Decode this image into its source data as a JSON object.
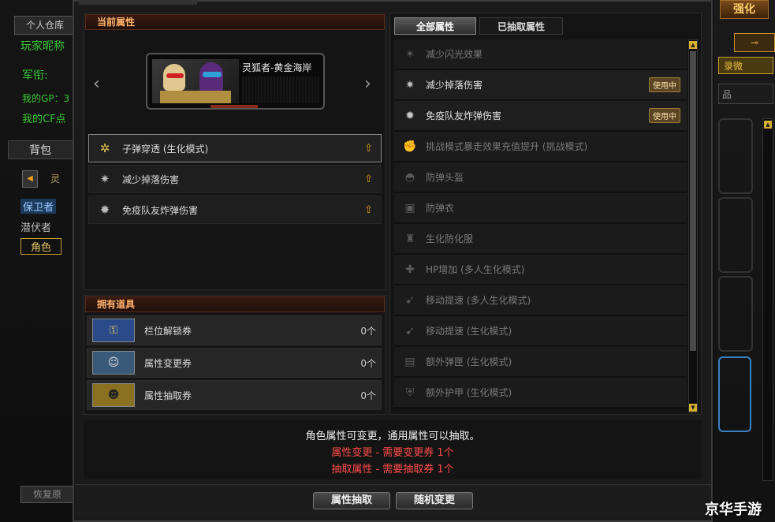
{
  "left_bg": {
    "tab_personal": "个人仓库",
    "player_nick": "玩家昵称",
    "rank": "军衔:",
    "gp": "我的GP：3",
    "cp": "我的CF点",
    "bag": "背包",
    "bag_item": "灵",
    "side_items": [
      "保卫者",
      "潜伏者",
      "角色"
    ],
    "bottom_button": "恢复原"
  },
  "right_bg": {
    "top_button": "强化",
    "middle_label": "录微",
    "small_label": "品"
  },
  "left_panel": {
    "header": "当前属性",
    "character_name": "灵狐者-黄金海岸",
    "attributes": [
      {
        "icon": "bullet-pierce-icon",
        "label": "子弹穿透 (生化模式)",
        "selected": true
      },
      {
        "icon": "fall-damage-icon",
        "label": "减少掉落伤害",
        "selected": false
      },
      {
        "icon": "grenade-immunity-icon",
        "label": "免疫队友炸弹伤害",
        "selected": false
      }
    ]
  },
  "items_panel": {
    "header": "拥有道具",
    "items": [
      {
        "label": "栏位解锁券",
        "count": "0个"
      },
      {
        "label": "属性变更券",
        "count": "0个"
      },
      {
        "label": "属性抽取券",
        "count": "0个"
      }
    ]
  },
  "right_panel": {
    "tabs": [
      "全部属性",
      "已抽取属性"
    ],
    "properties": [
      {
        "label": "减少闪光效果",
        "active": false,
        "badge": ""
      },
      {
        "label": "减少掉落伤害",
        "active": true,
        "badge": "使用中"
      },
      {
        "label": "免疫队友炸弹伤害",
        "active": true,
        "badge": "使用中"
      },
      {
        "label": "挑战模式暴走效果充值提升 (挑战模式)",
        "active": false,
        "badge": ""
      },
      {
        "label": "防弹头盔",
        "active": false,
        "badge": ""
      },
      {
        "label": "防弹衣",
        "active": false,
        "badge": ""
      },
      {
        "label": "生化防化服",
        "active": false,
        "badge": ""
      },
      {
        "label": "HP增加 (多人生化模式)",
        "active": false,
        "badge": ""
      },
      {
        "label": "移动提速 (多人生化模式)",
        "active": false,
        "badge": ""
      },
      {
        "label": "移动提速 (生化模式)",
        "active": false,
        "badge": ""
      },
      {
        "label": "额外弹匣 (生化模式)",
        "active": false,
        "badge": ""
      },
      {
        "label": "额外护甲 (生化模式)",
        "active": false,
        "badge": ""
      }
    ]
  },
  "info": {
    "line1": "角色属性可变更，通用属性可以抽取。",
    "line2": "属性变更 - 需要变更券 1个",
    "line3": "抽取属性 - 需要抽取券 1个"
  },
  "buttons": {
    "extract": "属性抽取",
    "random_change": "随机变更"
  },
  "watermark": "京华手游",
  "colors": {
    "header_text": "#ffb36b",
    "info_red": "#ff4b4b",
    "badge": "#5a4525",
    "green_text": "#36c836"
  }
}
